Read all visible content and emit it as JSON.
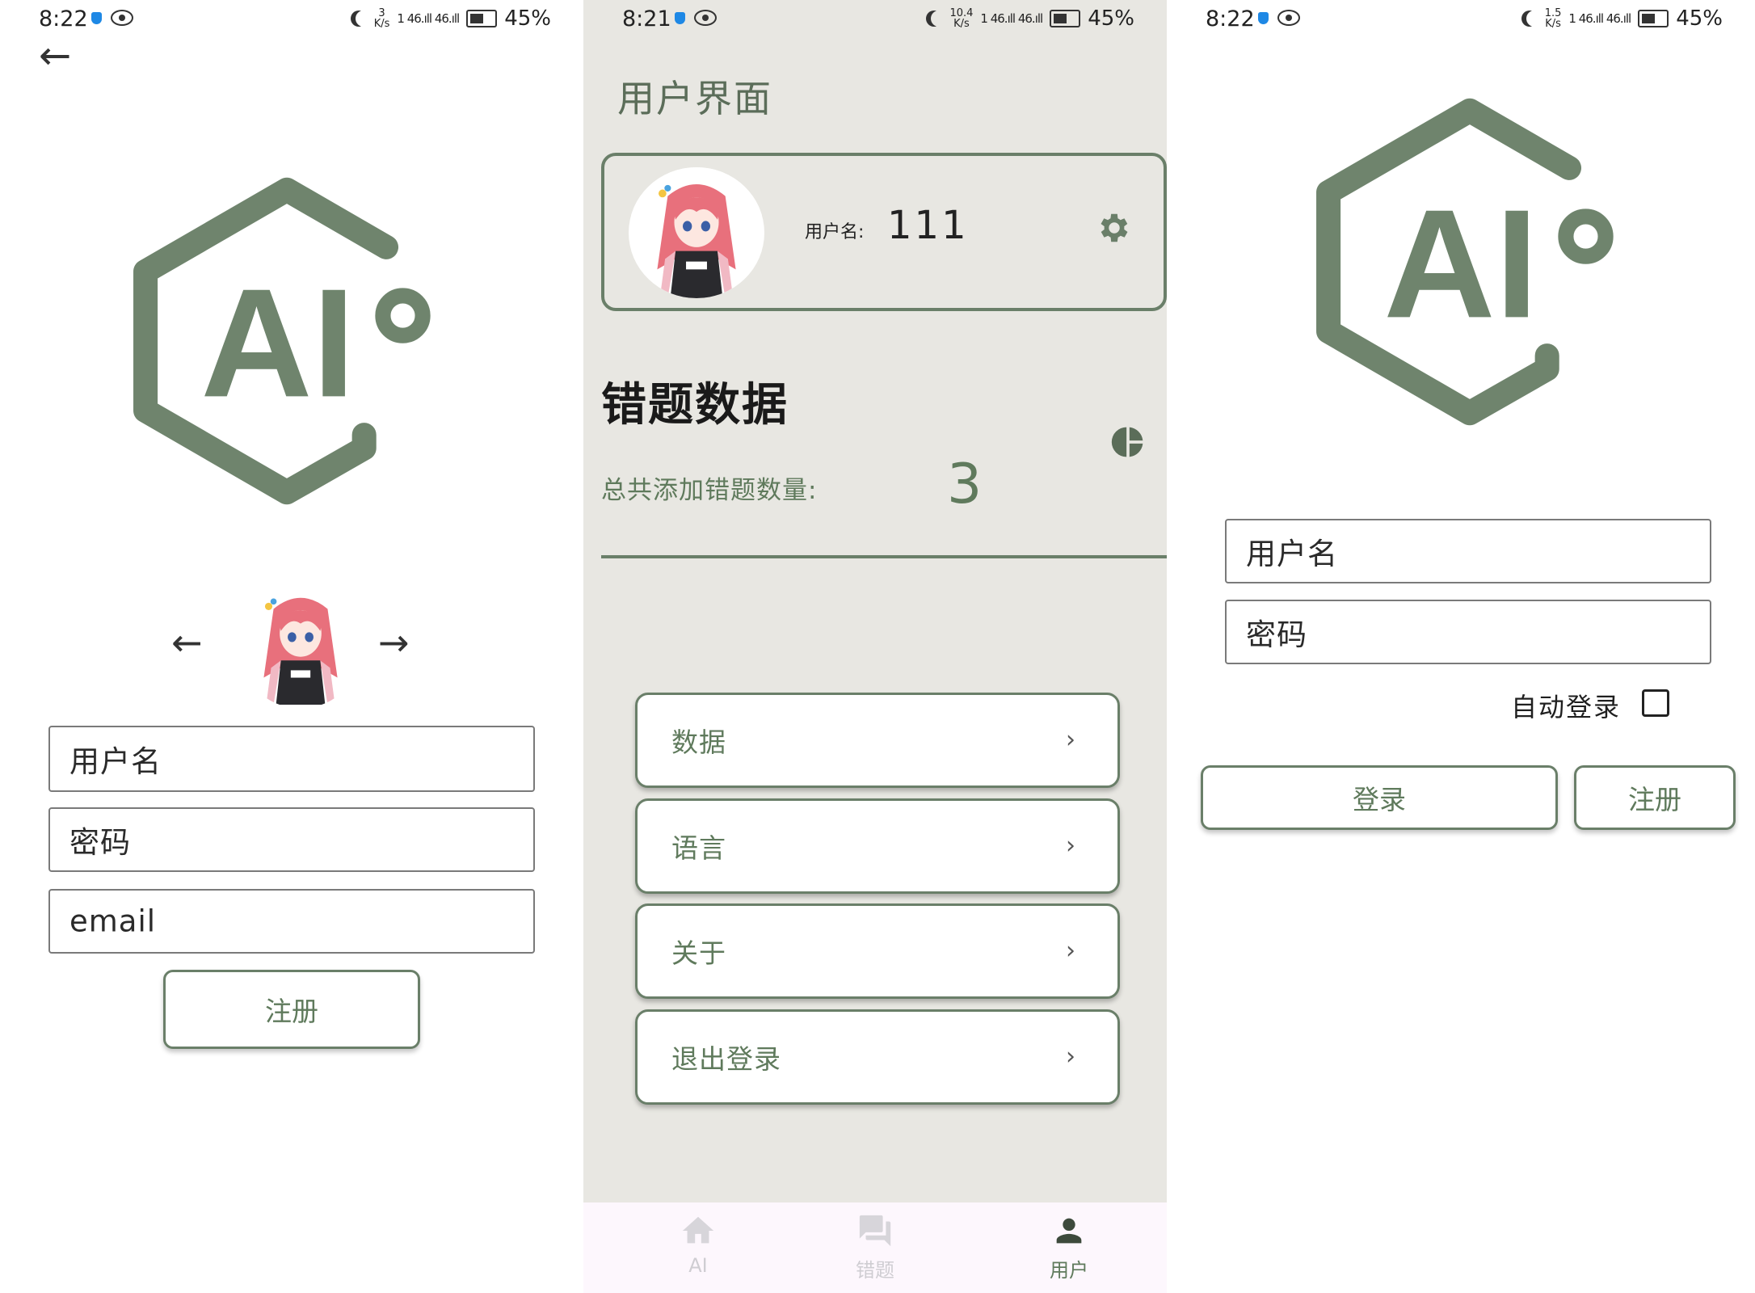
{
  "register_screen": {
    "status_bar": {
      "time": "8:22",
      "speed_value": "3",
      "speed_unit": "K/s",
      "signal": "1 46.ıll 46.ıll",
      "battery": "45%"
    },
    "back_icon": "arrow-left-icon",
    "username_placeholder": "用户名",
    "password_placeholder": "密码",
    "email_placeholder": "email",
    "register_button": "注册"
  },
  "profile_screen": {
    "status_bar": {
      "time": "8:21",
      "speed_value": "10.4",
      "speed_unit": "K/s",
      "signal": "1 46.ıll 46.ıll",
      "battery": "45%"
    },
    "title": "用户界面",
    "username_label": "用户名:",
    "username_value": "111",
    "section_title": "错题数据",
    "total_label": "总共添加错题数量:",
    "total_value": "3",
    "menu": [
      {
        "label": "数据"
      },
      {
        "label": "语言"
      },
      {
        "label": "关于"
      },
      {
        "label": "退出登录"
      }
    ],
    "bottom_nav": [
      {
        "label": "AI",
        "icon": "home-icon"
      },
      {
        "label": "错题",
        "icon": "forum-icon"
      },
      {
        "label": "用户",
        "icon": "person-icon"
      }
    ]
  },
  "login_screen": {
    "status_bar": {
      "time": "8:22",
      "speed_value": "1.5",
      "speed_unit": "K/s",
      "signal": "1 46.ıll 46.ıll",
      "battery": "45%"
    },
    "username_placeholder": "用户名",
    "password_placeholder": "密码",
    "auto_login_label": "自动登录",
    "login_button": "登录",
    "register_button": "注册"
  },
  "colors": {
    "accent_green": "#6a7f69",
    "text_green": "#5f7a5c",
    "panel_bg": "#e8e7e2",
    "avatar_hair": "#e8707c"
  }
}
